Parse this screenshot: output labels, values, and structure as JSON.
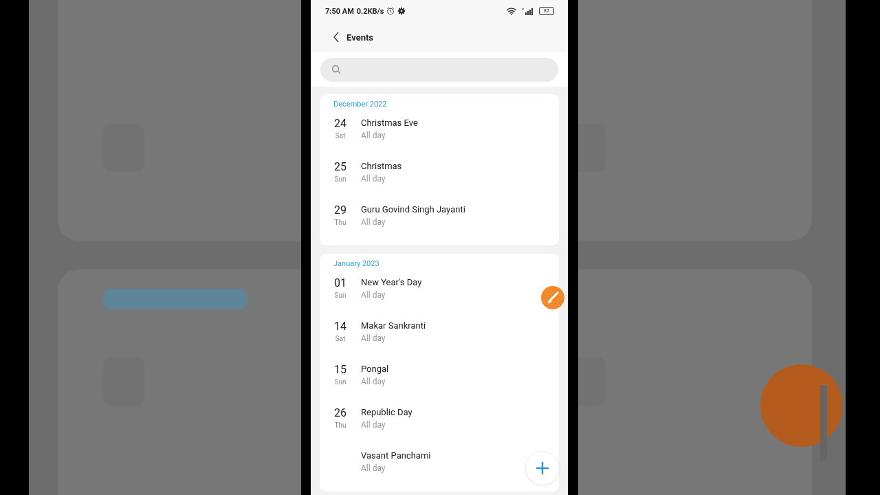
{
  "status_bar": {
    "time": "7:50 AM",
    "speed": "0.2KB/s",
    "battery": "87"
  },
  "header": {
    "title": "Events"
  },
  "sections": [
    {
      "title": "December 2022",
      "events": [
        {
          "day": "24",
          "weekday": "Sat",
          "name": "Christmas Eve",
          "time": "All day"
        },
        {
          "day": "25",
          "weekday": "Sun",
          "name": "Christmas",
          "time": "All day"
        },
        {
          "day": "29",
          "weekday": "Thu",
          "name": "Guru Govind Singh Jayanti",
          "time": "All day"
        }
      ]
    },
    {
      "title": "January 2023",
      "events": [
        {
          "day": "01",
          "weekday": "Sun",
          "name": "New Year's Day",
          "time": "All day"
        },
        {
          "day": "14",
          "weekday": "Sat",
          "name": "Makar Sankranti",
          "time": "All day"
        },
        {
          "day": "15",
          "weekday": "Sun",
          "name": "Pongal",
          "time": "All day"
        },
        {
          "day": "26",
          "weekday": "Thu",
          "name": "Republic Day",
          "time": "All day"
        },
        {
          "name": "Vasant Panchami",
          "time": "All day"
        }
      ]
    }
  ]
}
